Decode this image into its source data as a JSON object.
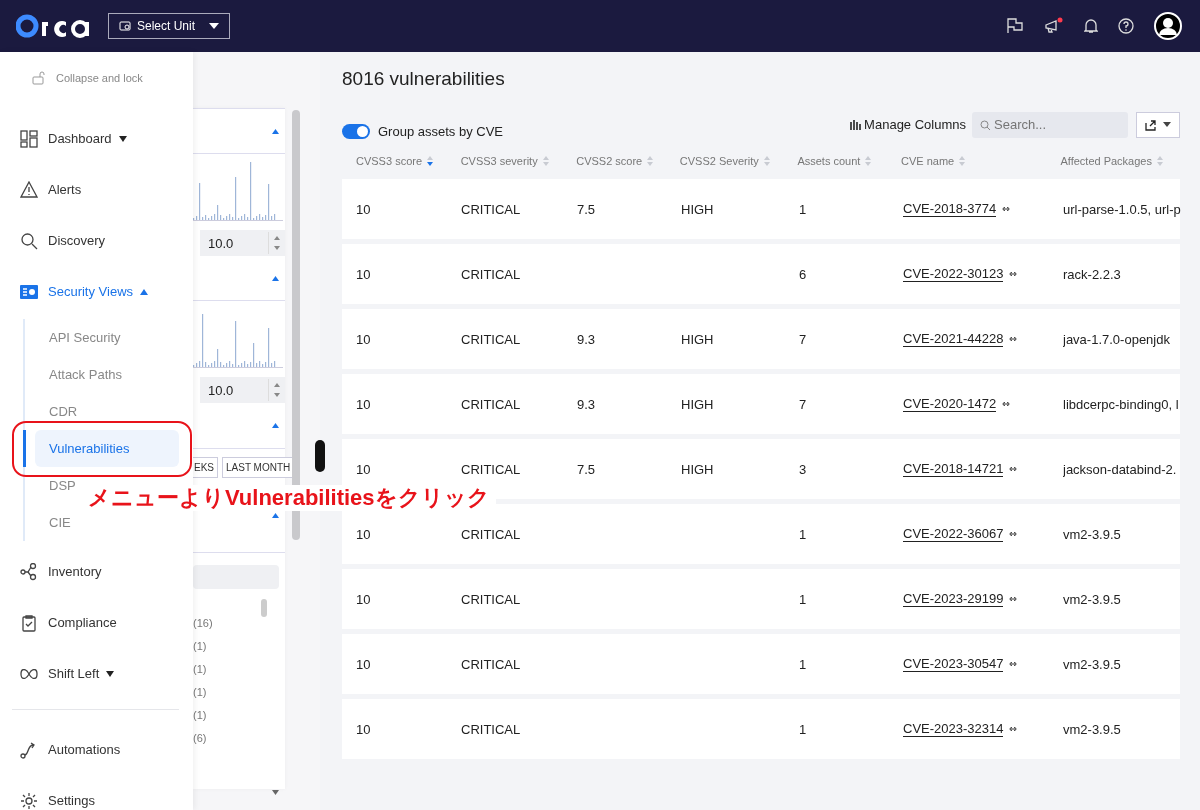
{
  "topbar": {
    "unit_select": {
      "label": "Select Unit"
    },
    "notifications_dot": true
  },
  "nav": {
    "collapse": "Collapse and lock",
    "items": [
      {
        "label": "Dashboard",
        "expanded": false,
        "selected": false
      },
      {
        "label": "Alerts",
        "selected": false
      },
      {
        "label": "Discovery",
        "selected": false
      },
      {
        "label": "Security Views",
        "expanded": true,
        "selected": true,
        "children": [
          {
            "label": "API Security",
            "selected": false
          },
          {
            "label": "Attack Paths",
            "selected": false
          },
          {
            "label": "CDR",
            "selected": false
          },
          {
            "label": "Vulnerabilities",
            "selected": true
          },
          {
            "label": "DSP",
            "selected": false
          },
          {
            "label": "CIE",
            "selected": false
          }
        ]
      },
      {
        "label": "Inventory",
        "selected": false
      },
      {
        "label": "Compliance",
        "selected": false
      },
      {
        "label": "Shift Left",
        "expanded": false,
        "selected": false
      },
      {
        "label": "Automations",
        "selected": false,
        "divider_before": true
      },
      {
        "label": "Settings",
        "selected": false
      }
    ]
  },
  "filters": {
    "score_fields": [
      "10.0",
      "10.0"
    ],
    "date_buttons": [
      "EKS",
      "LAST MONTH"
    ],
    "counts": [
      "(16)",
      "(1)",
      "(1)",
      "(1)",
      "(1)",
      "(6)"
    ]
  },
  "main": {
    "title": "8016 vulnerabilities",
    "group_toggle": {
      "label": "Group assets by CVE",
      "on": true
    },
    "manage_columns": "Manage Columns",
    "search": {
      "placeholder": "Search..."
    },
    "table": {
      "columns": [
        {
          "label": "CVSS3 score",
          "sorted": true
        },
        {
          "label": "CVSS3 severity",
          "sorted": false
        },
        {
          "label": "CVSS2 score",
          "sorted": false
        },
        {
          "label": "CVSS2 Severity",
          "sorted": false
        },
        {
          "label": "Assets count",
          "sorted": false
        },
        {
          "label": "CVE name",
          "sorted": false
        },
        {
          "label": "Affected Packages",
          "sorted": false
        }
      ],
      "rows": [
        [
          "10",
          "CRITICAL",
          "7.5",
          "HIGH",
          "1",
          "CVE-2018-3774",
          "url-parse-1.0.5, url-p"
        ],
        [
          "10",
          "CRITICAL",
          "",
          "",
          "6",
          "CVE-2022-30123",
          "rack-2.2.3"
        ],
        [
          "10",
          "CRITICAL",
          "9.3",
          "HIGH",
          "7",
          "CVE-2021-44228",
          "java-1.7.0-openjdk"
        ],
        [
          "10",
          "CRITICAL",
          "9.3",
          "HIGH",
          "7",
          "CVE-2020-1472",
          "libdcerpc-binding0, l"
        ],
        [
          "10",
          "CRITICAL",
          "7.5",
          "HIGH",
          "3",
          "CVE-2018-14721",
          "jackson-databind-2."
        ],
        [
          "10",
          "CRITICAL",
          "",
          "",
          "1",
          "CVE-2022-36067",
          "vm2-3.9.5"
        ],
        [
          "10",
          "CRITICAL",
          "",
          "",
          "1",
          "CVE-2023-29199",
          "vm2-3.9.5"
        ],
        [
          "10",
          "CRITICAL",
          "",
          "",
          "1",
          "CVE-2023-30547",
          "vm2-3.9.5"
        ],
        [
          "10",
          "CRITICAL",
          "",
          "",
          "1",
          "CVE-2023-32314",
          "vm2-3.9.5"
        ]
      ]
    }
  },
  "annotation": {
    "text": "メニューよりVulnerabilitiesをクリック"
  }
}
